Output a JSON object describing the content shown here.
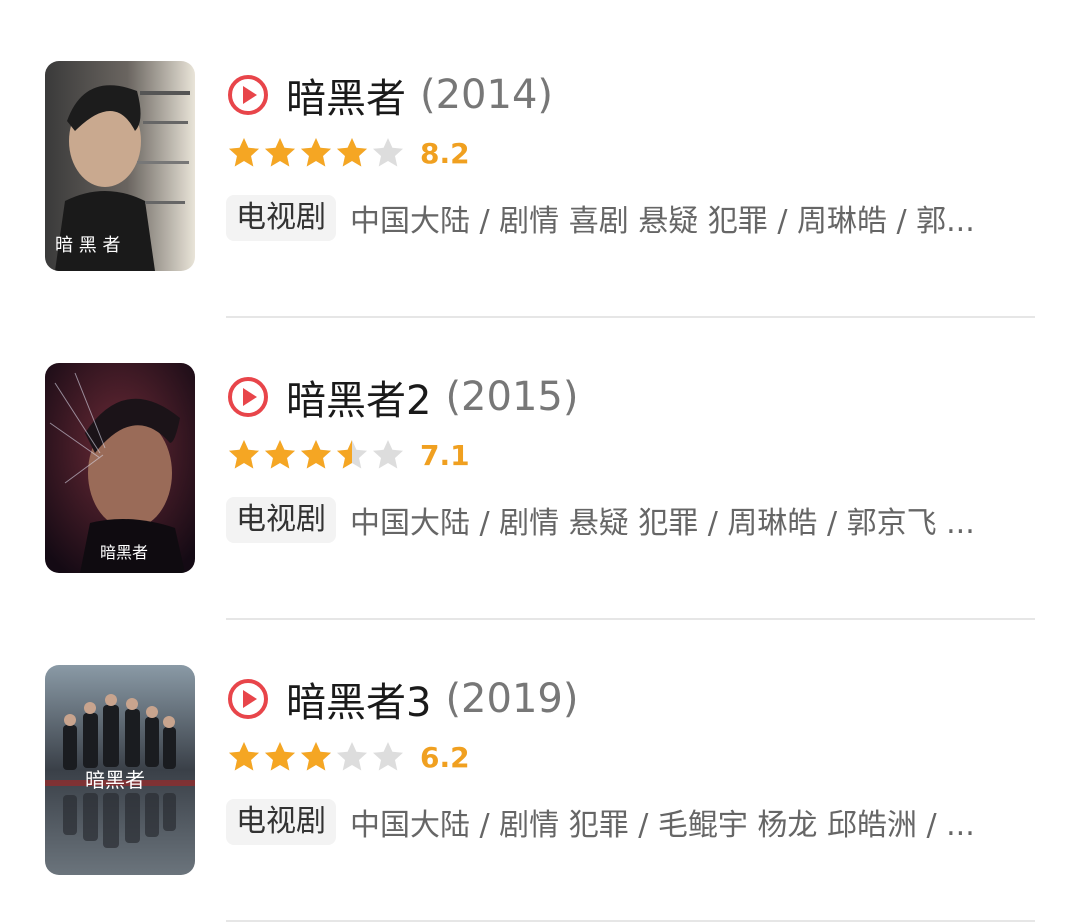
{
  "colors": {
    "star_filled": "#f5a623",
    "star_empty": "#dddddd",
    "score": "#f0a020",
    "play_icon": "#e8454a",
    "divider": "#e6e6e6"
  },
  "items": [
    {
      "poster_icon": "poster-image",
      "title": "暗黑者",
      "year": "(2014)",
      "rating_stars": 4,
      "score": "8.2",
      "badge": "电视剧",
      "meta": "中国大陆 / 剧情 喜剧 悬疑 犯罪 / 周琳皓 / 郭...",
      "poster_text": "暗 黑 者"
    },
    {
      "poster_icon": "poster-image",
      "title": "暗黑者2",
      "year": "(2015)",
      "rating_stars": 3.5,
      "score": "7.1",
      "badge": "电视剧",
      "meta": "中国大陆 / 剧情 悬疑 犯罪 / 周琳皓 / 郭京飞 ...",
      "poster_text": "暗黑者"
    },
    {
      "poster_icon": "poster-image",
      "title": "暗黑者3",
      "year": "(2019)",
      "rating_stars": 3,
      "score": "6.2",
      "badge": "电视剧",
      "meta": "中国大陆 / 剧情 犯罪 / 毛鲲宇 杨龙 邱皓洲 / ...",
      "poster_text": "暗黑者"
    }
  ]
}
